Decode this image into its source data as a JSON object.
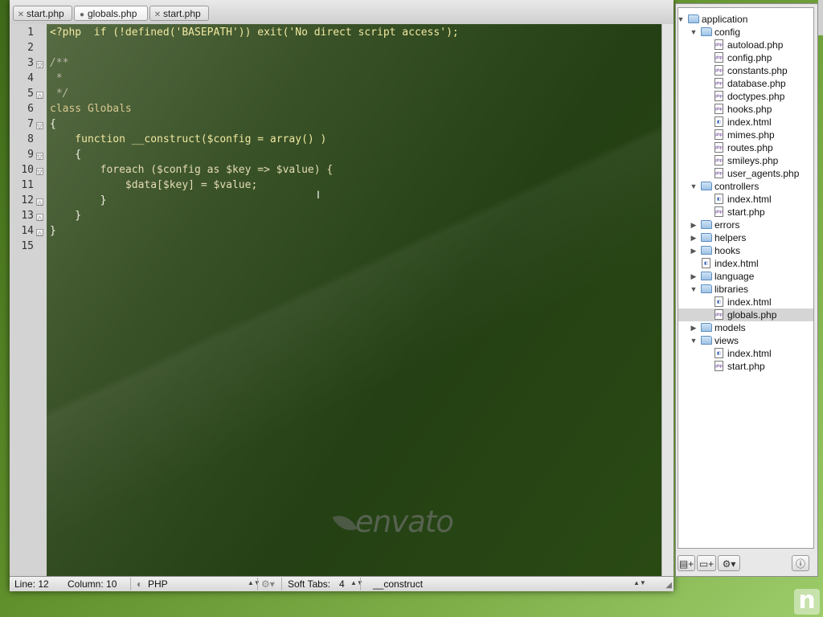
{
  "tabs": [
    {
      "label": "start.php",
      "modified": false,
      "active": false
    },
    {
      "label": "globals.php",
      "modified": true,
      "active": true
    },
    {
      "label": "start.php",
      "modified": false,
      "active": false
    }
  ],
  "code_lines": [
    "<?php  if (!defined('BASEPATH')) exit('No direct script access');",
    "",
    "/**",
    " *",
    " */",
    "class Globals",
    "{",
    "    function __construct($config = array() )",
    "    {",
    "        foreach ($config as $key => $value) {",
    "            $data[$key] = $value;",
    "        }",
    "    }",
    "}",
    ""
  ],
  "line_numbers": [
    "1",
    "2",
    "3",
    "4",
    "5",
    "6",
    "7",
    "8",
    "9",
    "10",
    "11",
    "12",
    "13",
    "14",
    "15"
  ],
  "watermark": "envato",
  "status": {
    "line": "Line: 12",
    "column": "Column: 10",
    "language": "PHP",
    "soft_tabs_label": "Soft Tabs:",
    "soft_tabs_value": "4",
    "symbol": "__construct"
  },
  "tree": [
    {
      "name": "application",
      "type": "folder",
      "depth": 0,
      "expanded": true
    },
    {
      "name": "config",
      "type": "folder",
      "depth": 1,
      "expanded": true
    },
    {
      "name": "autoload.php",
      "type": "php",
      "depth": 2
    },
    {
      "name": "config.php",
      "type": "php",
      "depth": 2
    },
    {
      "name": "constants.php",
      "type": "php",
      "depth": 2
    },
    {
      "name": "database.php",
      "type": "php",
      "depth": 2
    },
    {
      "name": "doctypes.php",
      "type": "php",
      "depth": 2
    },
    {
      "name": "hooks.php",
      "type": "php",
      "depth": 2
    },
    {
      "name": "index.html",
      "type": "html",
      "depth": 2
    },
    {
      "name": "mimes.php",
      "type": "php",
      "depth": 2
    },
    {
      "name": "routes.php",
      "type": "php",
      "depth": 2
    },
    {
      "name": "smileys.php",
      "type": "php",
      "depth": 2
    },
    {
      "name": "user_agents.php",
      "type": "php",
      "depth": 2
    },
    {
      "name": "controllers",
      "type": "folder",
      "depth": 1,
      "expanded": true
    },
    {
      "name": "index.html",
      "type": "html",
      "depth": 2
    },
    {
      "name": "start.php",
      "type": "php",
      "depth": 2
    },
    {
      "name": "errors",
      "type": "folder",
      "depth": 1,
      "expanded": false
    },
    {
      "name": "helpers",
      "type": "folder",
      "depth": 1,
      "expanded": false
    },
    {
      "name": "hooks",
      "type": "folder",
      "depth": 1,
      "expanded": false
    },
    {
      "name": "index.html",
      "type": "html",
      "depth": 1
    },
    {
      "name": "language",
      "type": "folder",
      "depth": 1,
      "expanded": false
    },
    {
      "name": "libraries",
      "type": "folder",
      "depth": 1,
      "expanded": true
    },
    {
      "name": "index.html",
      "type": "html",
      "depth": 2
    },
    {
      "name": "globals.php",
      "type": "php",
      "depth": 2,
      "selected": true
    },
    {
      "name": "models",
      "type": "folder",
      "depth": 1,
      "expanded": false
    },
    {
      "name": "views",
      "type": "folder",
      "depth": 1,
      "expanded": true
    },
    {
      "name": "index.html",
      "type": "html",
      "depth": 2
    },
    {
      "name": "start.php",
      "type": "php",
      "depth": 2
    }
  ],
  "drawer_buttons": [
    "new-file-icon",
    "new-folder-icon",
    "gear-icon",
    "info-icon"
  ],
  "logo_letter": "n"
}
